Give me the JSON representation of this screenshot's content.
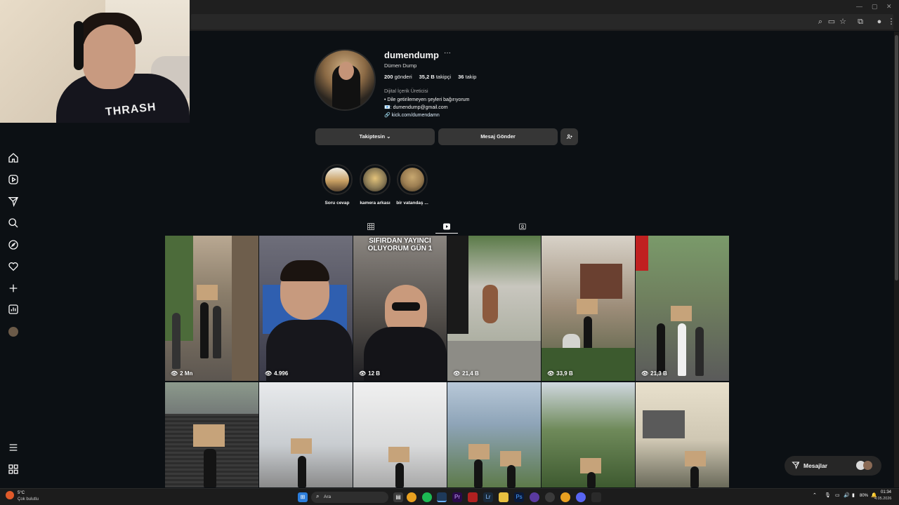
{
  "browser": {
    "window_controls": [
      "—",
      "▢",
      "✕"
    ]
  },
  "profile": {
    "username": "dumendump",
    "more": "···",
    "full_name": "Dümen Dump",
    "posts": "200",
    "posts_label": "gönderi",
    "followers": "35,2 B",
    "followers_label": "takipçi",
    "following": "36",
    "following_label": "takip",
    "category": "Dijital İçerik Üreticisi",
    "bio_line1": "• Dile getirilemeyen şeyleri bağırıyorum",
    "bio_line2": "📧: dumendump@gmail.com",
    "link": "🔗 kick.com/dumendamn"
  },
  "buttons": {
    "following": "Takiptesin ⌄",
    "message": "Mesaj Gönder",
    "suggest_icon": "person-add-icon"
  },
  "highlights": [
    {
      "label": "Soru cevap",
      "color": "#c9a063"
    },
    {
      "label": "kamera arkası",
      "color": "#8a7a55"
    },
    {
      "label": "bir vatandaş ...",
      "color": "#9c7e52"
    }
  ],
  "tabs": [
    {
      "name": "posts",
      "icon": "grid-icon",
      "active": false
    },
    {
      "name": "reels",
      "icon": "reels-icon",
      "active": true
    },
    {
      "name": "tagged",
      "icon": "tagged-icon",
      "active": false
    }
  ],
  "grid": {
    "row1": [
      {
        "views": "2 Mn",
        "bg": "#8a7d6a"
      },
      {
        "views": "4.996",
        "bg": "#3a3a48"
      },
      {
        "views": "12 B",
        "bg": "#4e4a46",
        "overlay": "SIFIRDAN YAYINCI OLUYORUM GÜN 1"
      },
      {
        "views": "21,4 B",
        "bg": "#9aa08f"
      },
      {
        "views": "33,9 B",
        "bg": "#9c8c78"
      },
      {
        "views": "21,3 B",
        "bg": "#6f7f5e"
      }
    ],
    "row2": [
      {
        "bg": "#6b6e70"
      },
      {
        "bg": "#c8ccd0"
      },
      {
        "bg": "#d9dadb"
      },
      {
        "bg": "#8ea4b8"
      },
      {
        "bg": "#6f8a5a"
      },
      {
        "bg": "#cfc7b3"
      }
    ]
  },
  "messages_pill": {
    "label": "Mesajlar"
  },
  "taskbar": {
    "weather_temp": "5°C",
    "weather_desc": "Çok bulutlu",
    "search_label": "Ara",
    "time": "01:34",
    "date": "4.05.2026",
    "battery": "80%"
  }
}
